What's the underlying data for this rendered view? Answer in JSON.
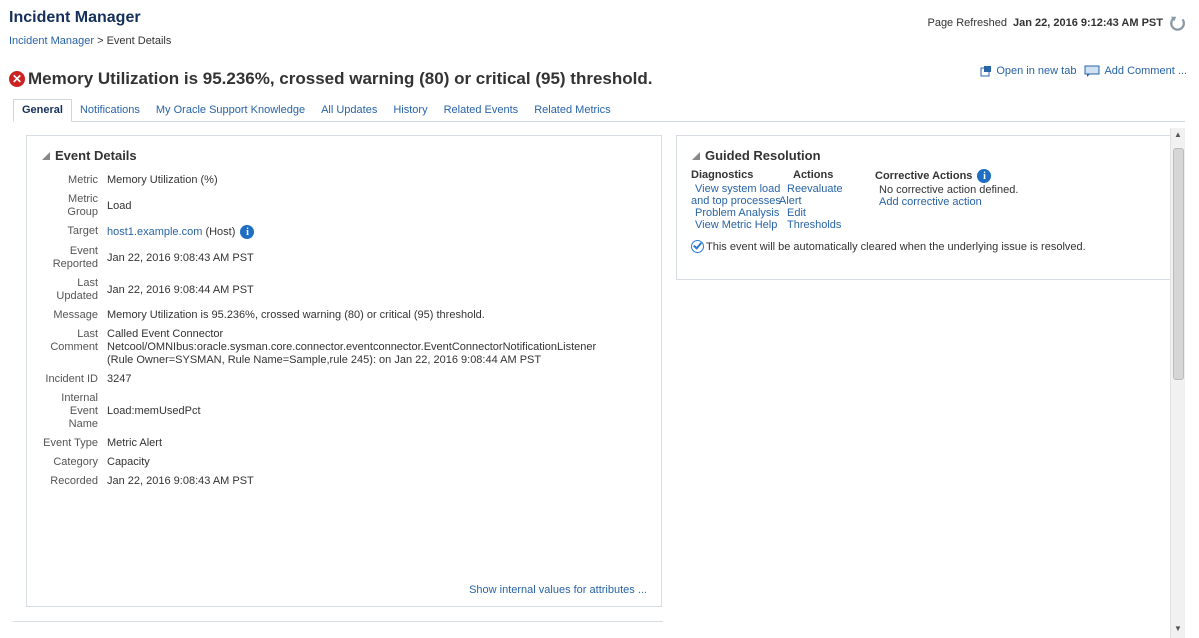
{
  "header": {
    "app_title": "Incident Manager",
    "breadcrumb": {
      "parent": "Incident Manager",
      "separator": ">",
      "current": "Event Details"
    },
    "refresh_label": "Page Refreshed",
    "refresh_time": "Jan 22, 2016 9:12:43 AM PST",
    "refresh_icon": "refresh-icon"
  },
  "title": {
    "severity_icon": "critical-icon",
    "text": "Memory Utilization is 95.236%, crossed warning (80) or critical (95) threshold.",
    "actions": {
      "open_new_tab": "Open in new tab",
      "add_comment": "Add Comment ..."
    }
  },
  "tabs": [
    {
      "label": "General",
      "active": true
    },
    {
      "label": "Notifications"
    },
    {
      "label": "My Oracle Support Knowledge"
    },
    {
      "label": "All Updates"
    },
    {
      "label": "History"
    },
    {
      "label": "Related Events"
    },
    {
      "label": "Related Metrics"
    }
  ],
  "event_details": {
    "heading": "Event Details",
    "metric": {
      "label": "Metric",
      "value": "Memory Utilization (%)"
    },
    "metric_group": {
      "label": "Metric Group",
      "value": "Load"
    },
    "target": {
      "label": "Target",
      "value": "host1.example.com",
      "suffix": "(Host)"
    },
    "event_reported": {
      "label": "Event Reported",
      "value": "Jan 22, 2016 9:08:43 AM PST"
    },
    "last_updated": {
      "label": "Last Updated",
      "value": "Jan 22, 2016 9:08:44 AM PST"
    },
    "message": {
      "label": "Message",
      "value": "Memory Utilization is 95.236%, crossed warning (80) or critical (95) threshold."
    },
    "last_comment": {
      "label": "Last Comment",
      "line1": "Called Event Connector",
      "line2": "Netcool/OMNIbus:oracle.sysman.core.connector.eventconnector.EventConnectorNotificationListener",
      "line3": "(Rule Owner=SYSMAN, Rule Name=Sample,rule 245): on Jan 22, 2016 9:08:44 AM PST"
    },
    "incident_id": {
      "label": "Incident ID",
      "value": "3247"
    },
    "internal_event_name": {
      "label": "Internal Event Name",
      "value": "Load:memUsedPct"
    },
    "event_type": {
      "label": "Event Type",
      "value": "Metric Alert"
    },
    "category": {
      "label": "Category",
      "value": "Capacity"
    },
    "recorded": {
      "label": "Recorded",
      "value": "Jan 22, 2016 9:08:43 AM PST"
    },
    "show_internal": "Show internal values for attributes ..."
  },
  "guided_resolution": {
    "heading": "Guided Resolution",
    "diagnostics": {
      "header": "Diagnostics",
      "items": [
        "View system load",
        "and top processes",
        "Problem Analysis",
        "View Metric Help"
      ]
    },
    "actions": {
      "header": "Actions",
      "items": [
        "Reevaluate",
        "Alert",
        "Edit",
        "Thresholds"
      ]
    },
    "corrective": {
      "header": "Corrective Actions",
      "none": "No corrective action defined.",
      "add": "Add corrective action"
    },
    "note": "This event will be automatically cleared when the underlying issue is resolved."
  }
}
